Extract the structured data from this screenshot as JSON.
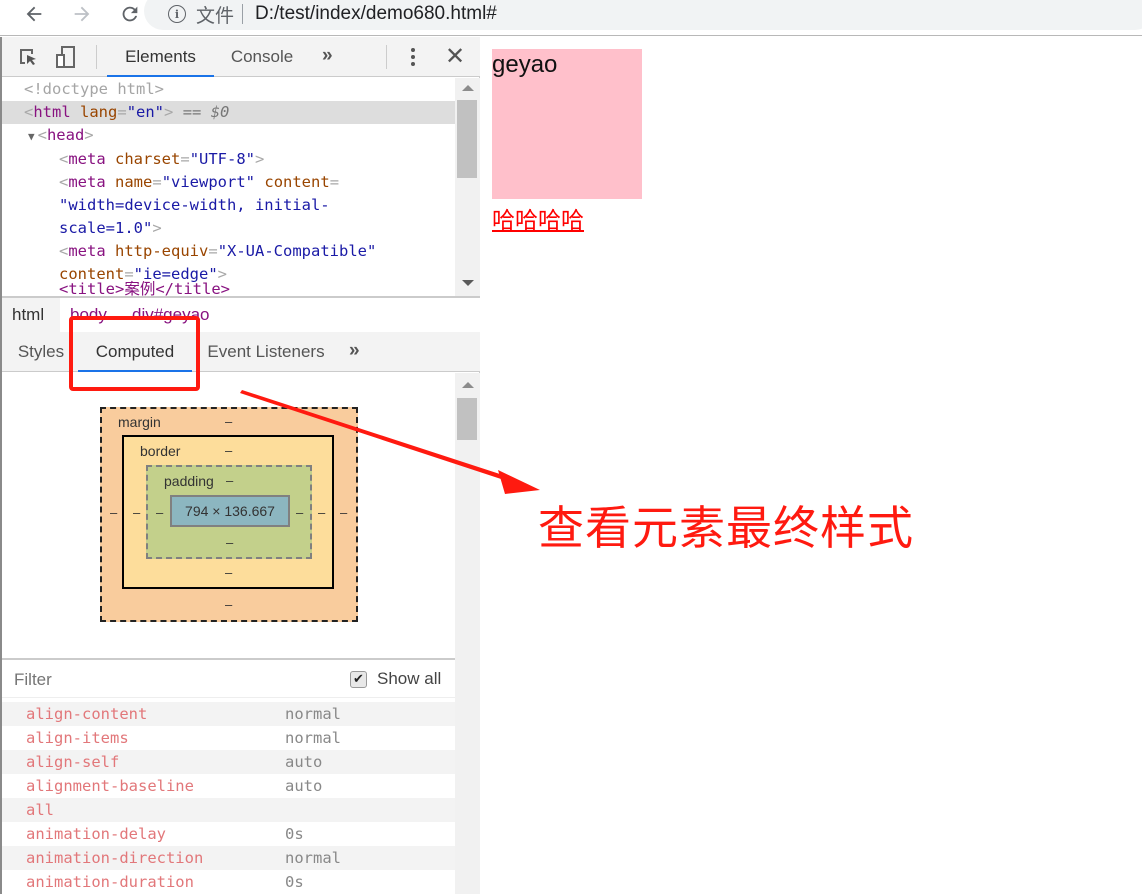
{
  "browser": {
    "scheme_label": "文件",
    "url": "D:/test/index/demo680.html#"
  },
  "devtools": {
    "tabs": [
      {
        "label": "Elements",
        "active": true
      },
      {
        "label": "Console",
        "active": false
      }
    ],
    "more_tabs": "»",
    "close": "✕",
    "dom_tree": {
      "doctype": "<!doctype html>",
      "html_tag": "html",
      "html_attr_name": "lang",
      "html_attr_value": "\"en\"",
      "selected_marker": "== $0",
      "head_tag": "head",
      "meta1_attr": "charset",
      "meta1_value": "\"UTF-8\"",
      "meta2_attr1": "name",
      "meta2_value1": "\"viewport\"",
      "meta2_attr2": "content",
      "meta2_value2_line1": "\"width=device-width, initial-",
      "meta2_value2_line2": "scale=1.0\"",
      "meta3_attr1": "http-equiv",
      "meta3_value1": "\"X-UA-Compatible\"",
      "meta3_attr2": "content",
      "meta3_value2": "\"ie=edge\"",
      "meta_tag": "meta",
      "partial_line": "<title>案例</title>"
    },
    "breadcrumb": [
      "html",
      "body",
      "div#geyao"
    ],
    "subtabs": [
      {
        "label": "Styles",
        "active": false
      },
      {
        "label": "Computed",
        "active": true
      },
      {
        "label": "Event Listeners",
        "active": false
      }
    ],
    "more_subtabs": "»",
    "box_model": {
      "margin_label": "margin",
      "border_label": "border",
      "padding_label": "padding",
      "content_size": "794 × 136.667",
      "empty_value": "–"
    },
    "filter": {
      "placeholder": "Filter",
      "show_all_label": "Show all",
      "show_all_checked": true
    },
    "computed_properties": [
      {
        "name": "align-content",
        "value": "normal"
      },
      {
        "name": "align-items",
        "value": "normal"
      },
      {
        "name": "align-self",
        "value": "auto"
      },
      {
        "name": "alignment-baseline",
        "value": "auto"
      },
      {
        "name": "all",
        "value": ""
      },
      {
        "name": "animation-delay",
        "value": "0s"
      },
      {
        "name": "animation-direction",
        "value": "normal"
      },
      {
        "name": "animation-duration",
        "value": "0s"
      }
    ]
  },
  "page": {
    "box_text": "geyao",
    "link_text": "哈哈哈哈",
    "box_color": "#ffc0cb",
    "link_color": "#ff0000"
  },
  "annotation": {
    "text": "查看元素最终样式",
    "color": "#ff1a10"
  }
}
